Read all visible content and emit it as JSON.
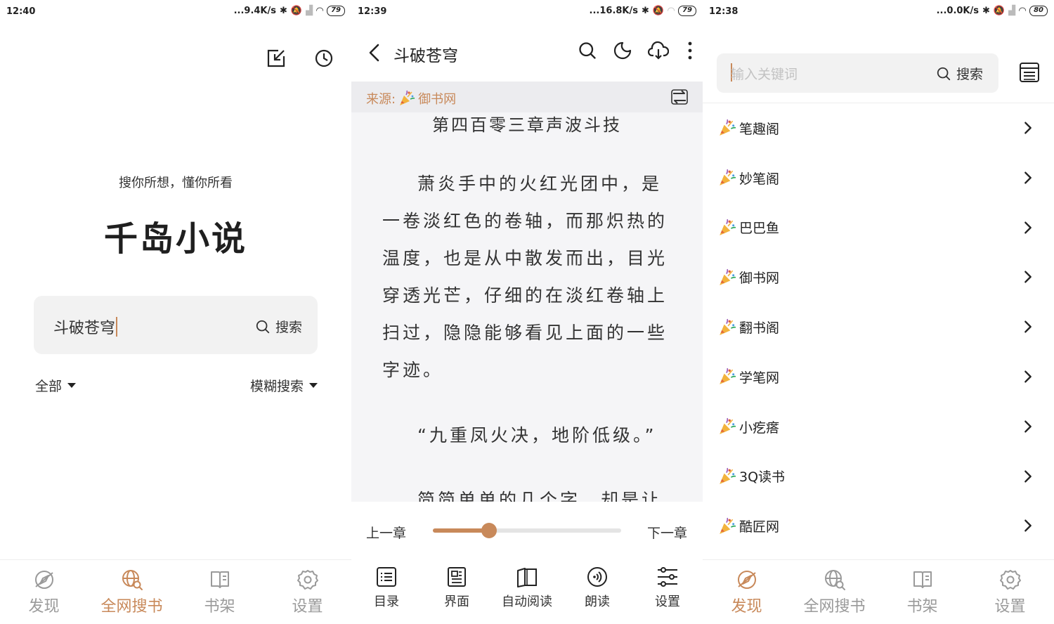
{
  "screen1": {
    "status": {
      "time": "12:40",
      "speed": "...9.4K/s",
      "battery": "79"
    },
    "slogan": "搜你所想，懂你所看",
    "brand": "千岛小说",
    "search": {
      "value": "斗破苍穹",
      "button": "搜索"
    },
    "filter_left": "全部",
    "filter_right": "模糊搜索",
    "nav": [
      "发现",
      "全网搜书",
      "书架",
      "设置"
    ]
  },
  "screen2": {
    "status": {
      "time": "12:39",
      "speed": "...16.8K/s",
      "battery": "79"
    },
    "title": "斗破苍穹",
    "source_label": "来源:",
    "source_name": "御书网",
    "chapter": "第四百零三章声波斗技",
    "paragraphs": [
      "萧炎手中的火红光团中，是一卷淡红色的卷轴，而那炽热的温度，也是从中散发而出，目光穿透光芒，仔细的在淡红卷轴上扫过，隐隐能够看见上面的一些字迹。",
      "“九重凤火决，地阶低级。”",
      "简简单单的几个字，却是让"
    ],
    "prev": "上一章",
    "next": "下一章",
    "progress": 0.3,
    "tools": [
      "目录",
      "界面",
      "自动阅读",
      "朗读",
      "设置"
    ]
  },
  "screen3": {
    "status": {
      "time": "12:38",
      "speed": "...0.0K/s",
      "battery": "80"
    },
    "search": {
      "placeholder": "输入关键词",
      "button": "搜索"
    },
    "sources": [
      "笔趣阁",
      "妙笔阁",
      "巴巴鱼",
      "御书网",
      "翻书阁",
      "学笔网",
      "小疙瘩",
      "3Q读书",
      "酷匠网"
    ],
    "nav": [
      "发现",
      "全网搜书",
      "书架",
      "设置"
    ]
  },
  "colors": {
    "accent": "#c8895a",
    "inactive": "#9a9a9a",
    "reader_bg": "#f5f5f7"
  }
}
